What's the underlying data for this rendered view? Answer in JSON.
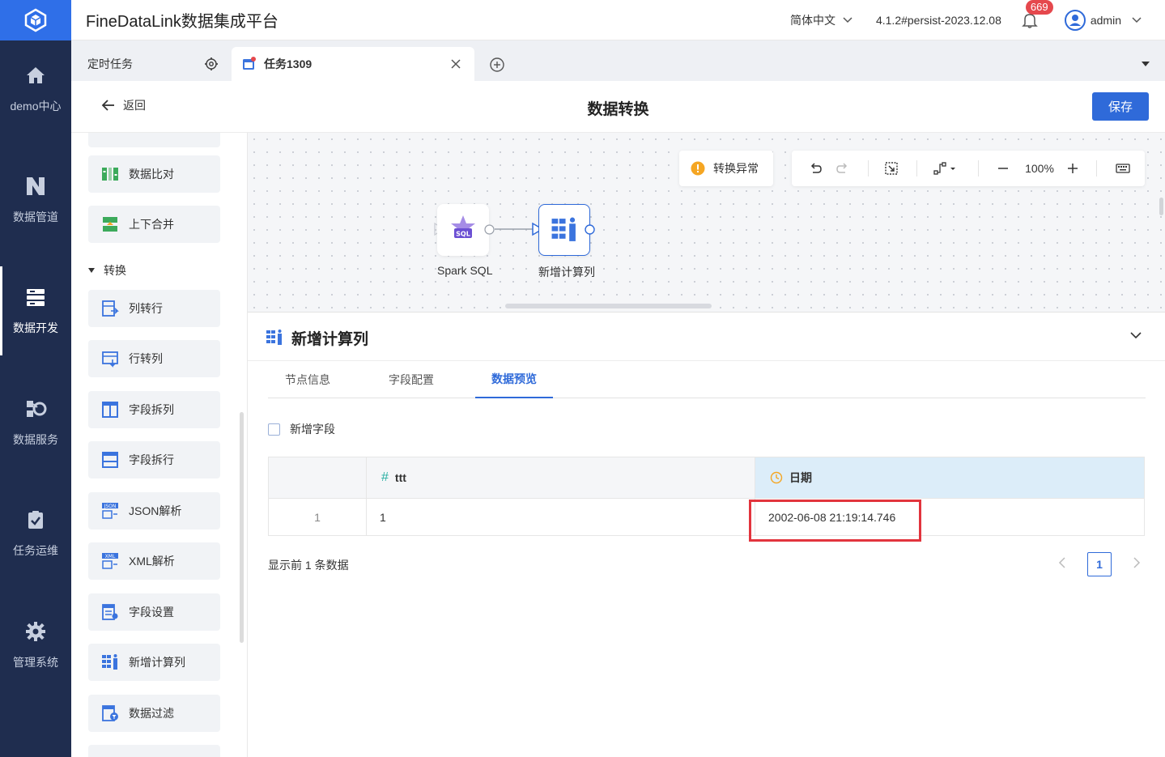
{
  "header": {
    "app_title": "FineDataLink数据集成平台",
    "language": "简体中文",
    "version": "4.1.2#persist-2023.12.08",
    "notification_count": "669",
    "username": "admin"
  },
  "leftnav": {
    "items": [
      {
        "label": "demo中心",
        "icon": "home-icon"
      },
      {
        "label": "数据管道",
        "icon": "pipeline-icon"
      },
      {
        "label": "数据开发",
        "icon": "dev-icon",
        "active": true
      },
      {
        "label": "数据服务",
        "icon": "service-icon"
      },
      {
        "label": "任务运维",
        "icon": "ops-icon"
      },
      {
        "label": "管理系统",
        "icon": "gear-icon"
      }
    ]
  },
  "tabs": {
    "fixed_label": "定时任务",
    "active_label": "任务1309"
  },
  "subheader": {
    "back_label": "返回",
    "title": "数据转换",
    "save_label": "保存"
  },
  "components": {
    "top_items": [
      "数据比对",
      "上下合并"
    ],
    "group_label": "转换",
    "transform_items": [
      "列转行",
      "行转列",
      "字段拆列",
      "字段拆行",
      "JSON解析",
      "XML解析",
      "字段设置",
      "新增计算列",
      "数据过滤"
    ]
  },
  "canvas": {
    "status_label": "转换异常",
    "zoom": "100%",
    "nodes": [
      {
        "label": "Spark SQL",
        "badge": "SQL"
      },
      {
        "label": "新增计算列"
      }
    ]
  },
  "bottom_panel": {
    "title": "新增计算列",
    "tabs": [
      "节点信息",
      "字段配置",
      "数据预览"
    ],
    "active_tab": 2,
    "checkbox_label": "新增字段",
    "table": {
      "columns": [
        {
          "name": "ttt",
          "type_icon": "#"
        },
        {
          "name": "日期",
          "type_icon": "clock-icon"
        }
      ],
      "rows": [
        {
          "index": "1",
          "cells": [
            "1",
            "2002-06-08 21:19:14.746"
          ]
        }
      ]
    },
    "row_summary": "显示前 1 条数据",
    "current_page": "1"
  },
  "colors": {
    "nav_bg": "#1f2d4f",
    "accent": "#2f6ad9",
    "highlight": "#e2343d",
    "warning": "#f5a623"
  }
}
